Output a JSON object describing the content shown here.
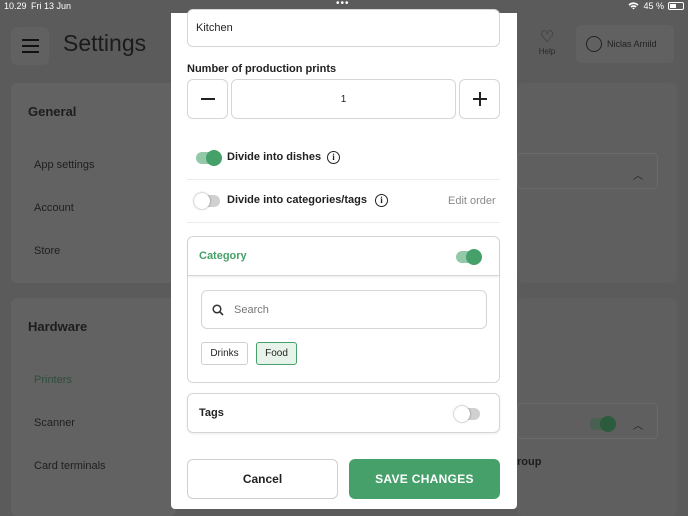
{
  "status_bar": {
    "time": "10.29",
    "date": "Fri 13 Jun",
    "battery": "45 %"
  },
  "background": {
    "title": "Settings",
    "help_label": "Help",
    "user_name": "Niclas Arnild",
    "general": {
      "heading": "General",
      "items": [
        "App settings",
        "Account",
        "Store"
      ]
    },
    "hardware": {
      "heading": "Hardware",
      "items": [
        "Printers",
        "Scanner",
        "Card terminals"
      ]
    },
    "partial_text": "roup"
  },
  "modal": {
    "printer_name": "Kitchen",
    "prints": {
      "label": "Number of production prints",
      "value": "1"
    },
    "divide_dishes": {
      "label": "Divide into dishes",
      "enabled": true
    },
    "divide_categories": {
      "label": "Divide into categories/tags",
      "enabled": false,
      "edit_order_label": "Edit order"
    },
    "category": {
      "label": "Category",
      "enabled": true,
      "search_placeholder": "Search",
      "chips": [
        {
          "label": "Drinks",
          "selected": false
        },
        {
          "label": "Food",
          "selected": true
        }
      ]
    },
    "tags": {
      "label": "Tags",
      "enabled": false
    },
    "cancel_label": "Cancel",
    "save_label": "SAVE CHANGES"
  },
  "colors": {
    "accent": "#46a06a",
    "accent_light": "#93c9a9",
    "overlay": "#5b5b5b"
  }
}
